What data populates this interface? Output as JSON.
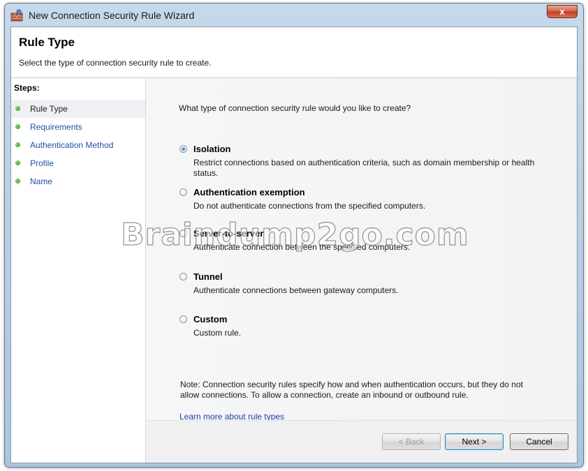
{
  "window": {
    "title": "New Connection Security Rule Wizard",
    "close_label": "x"
  },
  "header": {
    "title": "Rule Type",
    "subtitle": "Select the type of connection security rule to create."
  },
  "steps": {
    "heading": "Steps:",
    "items": [
      {
        "label": "Rule Type"
      },
      {
        "label": "Requirements"
      },
      {
        "label": "Authentication Method"
      },
      {
        "label": "Profile"
      },
      {
        "label": "Name"
      }
    ]
  },
  "main": {
    "question": "What type of connection security rule would you like to create?",
    "options": [
      {
        "label": "Isolation",
        "description": "Restrict connections based on authentication criteria, such as domain membership or health status.",
        "checked": true
      },
      {
        "label": "Authentication exemption",
        "description": "Do not authenticate connections from the specified computers.",
        "checked": false
      },
      {
        "label": "Server-to-server",
        "description": "Authenticate connection between the specified computers.",
        "checked": false
      },
      {
        "label": "Tunnel",
        "description": "Authenticate connections between gateway computers.",
        "checked": false
      },
      {
        "label": "Custom",
        "description": "Custom rule.",
        "checked": false
      }
    ],
    "note": "Note:  Connection security rules specify how and when authentication occurs, but they do not allow connections.  To allow a connection, create an inbound or outbound rule.",
    "learn_more": "Learn more about rule types"
  },
  "buttons": {
    "back": "< Back",
    "next": "Next >",
    "cancel": "Cancel"
  },
  "watermark": "Braindump2go.com",
  "colors": {
    "link": "#1f3ea8",
    "step_dot": "#3a9a23",
    "radio_selected": "#1f5fb5"
  },
  "icons": {
    "app": "firewall-wall-icon"
  }
}
